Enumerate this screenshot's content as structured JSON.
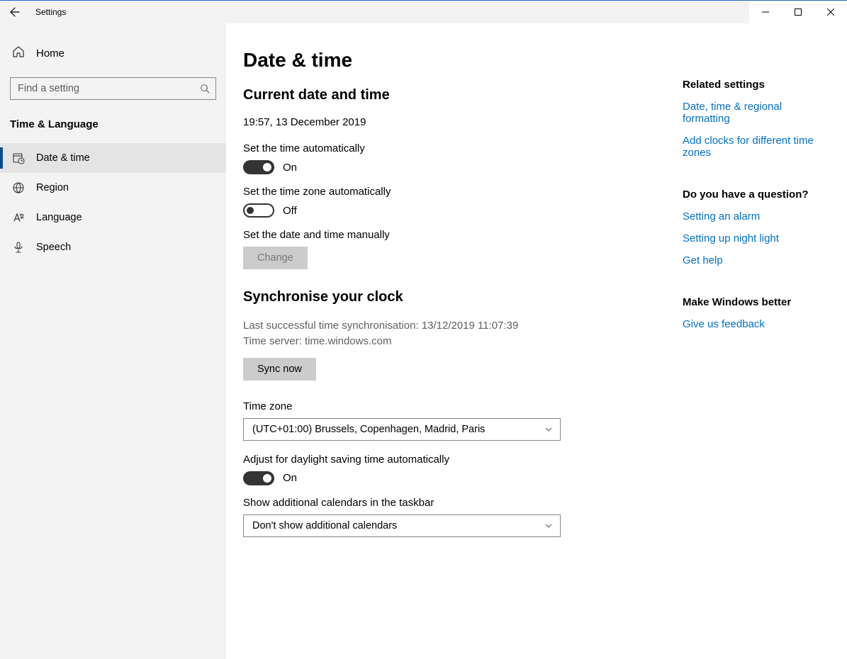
{
  "titlebar": {
    "app_name": "Settings"
  },
  "sidebar": {
    "home": "Home",
    "search_placeholder": "Find a setting",
    "category": "Time & Language",
    "items": [
      {
        "label": "Date & time",
        "icon": "calendar-clock-icon",
        "selected": true
      },
      {
        "label": "Region",
        "icon": "globe-icon",
        "selected": false
      },
      {
        "label": "Language",
        "icon": "language-icon",
        "selected": false
      },
      {
        "label": "Speech",
        "icon": "microphone-icon",
        "selected": false
      }
    ]
  },
  "page": {
    "title": "Date & time",
    "section_current": "Current date and time",
    "current_datetime": "19:57, 13 December 2019",
    "auto_time_label": "Set the time automatically",
    "auto_time_state": "On",
    "auto_tz_label": "Set the time zone automatically",
    "auto_tz_state": "Off",
    "manual_label": "Set the date and time manually",
    "change_button": "Change",
    "sync_heading": "Synchronise your clock",
    "sync_last": "Last successful time synchronisation: 13/12/2019 11:07:39",
    "sync_server": "Time server: time.windows.com",
    "sync_button": "Sync now",
    "tz_label": "Time zone",
    "tz_value": "(UTC+01:00) Brussels, Copenhagen, Madrid, Paris",
    "dst_label": "Adjust for daylight saving time automatically",
    "dst_state": "On",
    "addcal_label": "Show additional calendars in the taskbar",
    "addcal_value": "Don't show additional calendars"
  },
  "side_panel": {
    "related_head": "Related settings",
    "related_links": [
      "Date, time & regional formatting",
      "Add clocks for different time zones"
    ],
    "question_head": "Do you have a question?",
    "question_links": [
      "Setting an alarm",
      "Setting up night light",
      "Get help"
    ],
    "better_head": "Make Windows better",
    "better_links": [
      "Give us feedback"
    ]
  }
}
